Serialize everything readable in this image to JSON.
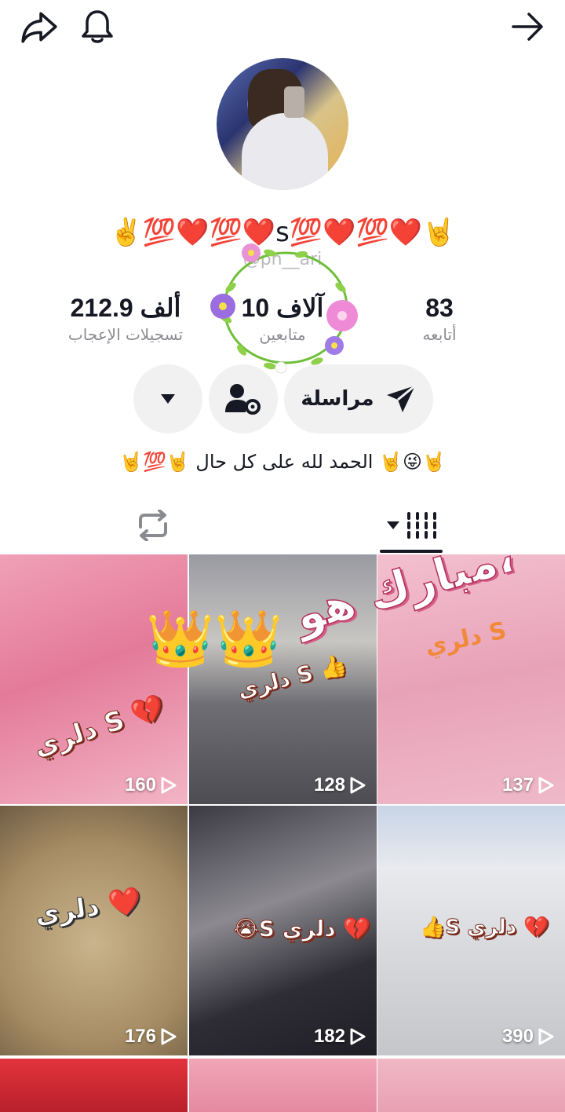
{
  "header": {
    "share_icon": "share-arrow-icon",
    "bell_icon": "bell-icon",
    "back_icon": "arrow-right-icon"
  },
  "profile": {
    "nickname": "✌️💯❤️💯❤️s💯❤️💯❤️🤘",
    "username": "@pn__ari",
    "stats": {
      "likes": {
        "num": "212.9 ألف",
        "label": "تسجيلات الإعجاب"
      },
      "followers": {
        "num": "10 آلاف",
        "label": "متابعين"
      },
      "following": {
        "num": "83",
        "label": "أتابعه"
      }
    },
    "buttons": {
      "message": "مراسلة",
      "friends_icon": "person-settings-icon",
      "dropdown_icon": "caret-down-icon"
    },
    "bio": "🤘💯🤘 الحمد لله على كل حال 🤘😜🤘"
  },
  "tabs": {
    "videos_icon": "grid-lines-icon",
    "reposts_icon": "repost-icon"
  },
  "overlay": {
    "mubarak_text": "مبارك هو،",
    "crowns": "👑👑"
  },
  "videos": [
    {
      "views": "160",
      "caption": "دلري S 💔",
      "bg": "#e88aa8"
    },
    {
      "views": "128",
      "caption": "دلري S 👍",
      "bg": "#8d8c94"
    },
    {
      "views": "137",
      "caption": "دلري S",
      "bg": "#e6a0b8"
    },
    {
      "views": "176",
      "caption": "دلري ❤️",
      "bg": "#b8a07c"
    },
    {
      "views": "182",
      "caption": "😭S دلري 💔",
      "bg": "#4b4a55"
    },
    {
      "views": "390",
      "caption": "👍S دلري 💔",
      "bg": "#d9dce2"
    }
  ],
  "colors": {
    "pill_bg": "#f1f1f2",
    "text_primary": "#161823",
    "text_secondary": "#8a8b91"
  }
}
